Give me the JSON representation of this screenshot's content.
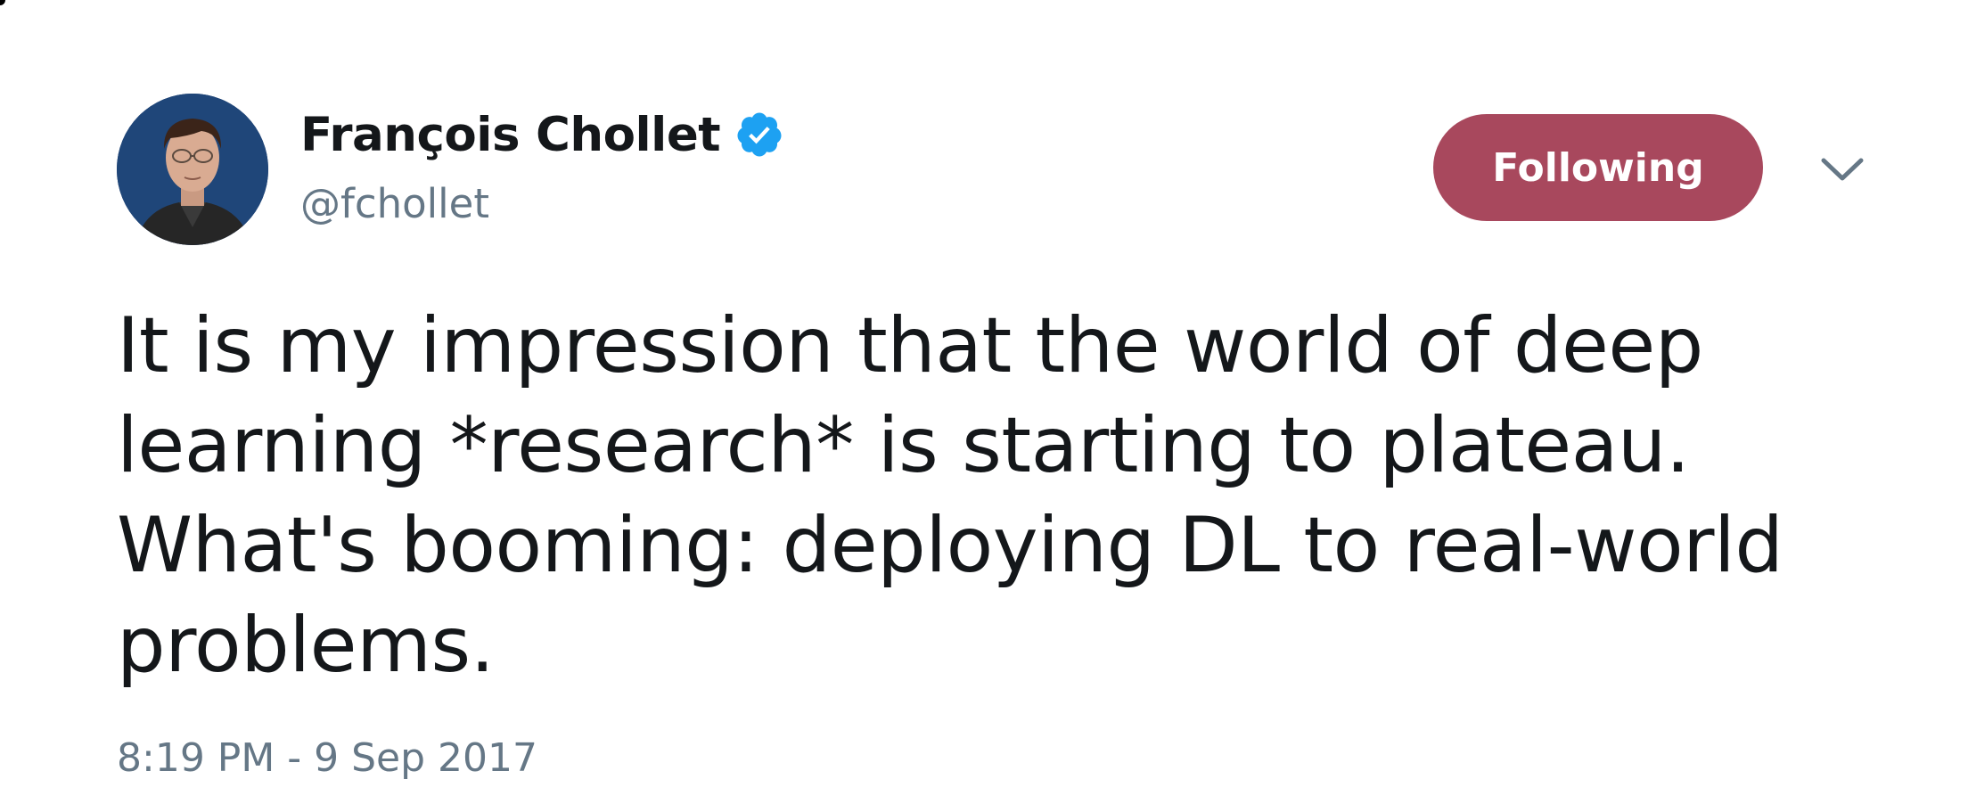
{
  "author": {
    "display_name": "François Chollet",
    "handle": "@fchollet",
    "verified": true,
    "avatar_icon": "profile-photo"
  },
  "follow_button": {
    "label": "Following",
    "color": "#a8485d"
  },
  "menu": {
    "icon": "chevron-down-icon"
  },
  "tweet": {
    "text": "It is my impression that the world of deep\nlearning *research* is starting to plateau.\nWhat's booming: deploying DL to real-world\nproblems.",
    "timestamp": "8:19 PM - 9 Sep 2017"
  },
  "colors": {
    "text_primary": "#14171a",
    "text_secondary": "#657786",
    "verified_blue": "#1da1f2"
  }
}
